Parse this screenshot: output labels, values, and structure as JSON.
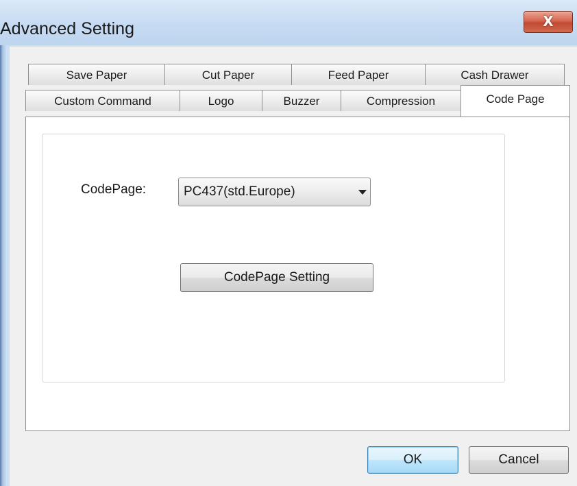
{
  "window": {
    "title": "Advanced Setting",
    "close_glyph": "X"
  },
  "tabs": {
    "row_back": [
      {
        "label": "Save Paper"
      },
      {
        "label": "Cut Paper"
      },
      {
        "label": "Feed Paper"
      },
      {
        "label": "Cash Drawer"
      }
    ],
    "row_front": [
      {
        "label": "Custom Command"
      },
      {
        "label": "Logo"
      },
      {
        "label": "Buzzer"
      },
      {
        "label": "Compression"
      },
      {
        "label": "Code Page",
        "active": true
      }
    ]
  },
  "codepage_panel": {
    "label": "CodePage:",
    "selected_value": "PC437(std.Europe)",
    "setting_button": "CodePage Setting"
  },
  "footer": {
    "ok_label": "OK",
    "cancel_label": "Cancel"
  },
  "colors": {
    "frame": "#c9dff3",
    "client": "#f0f0f0",
    "close_button": "#c94a33",
    "ok_button_accent": "#3c7fb1"
  }
}
